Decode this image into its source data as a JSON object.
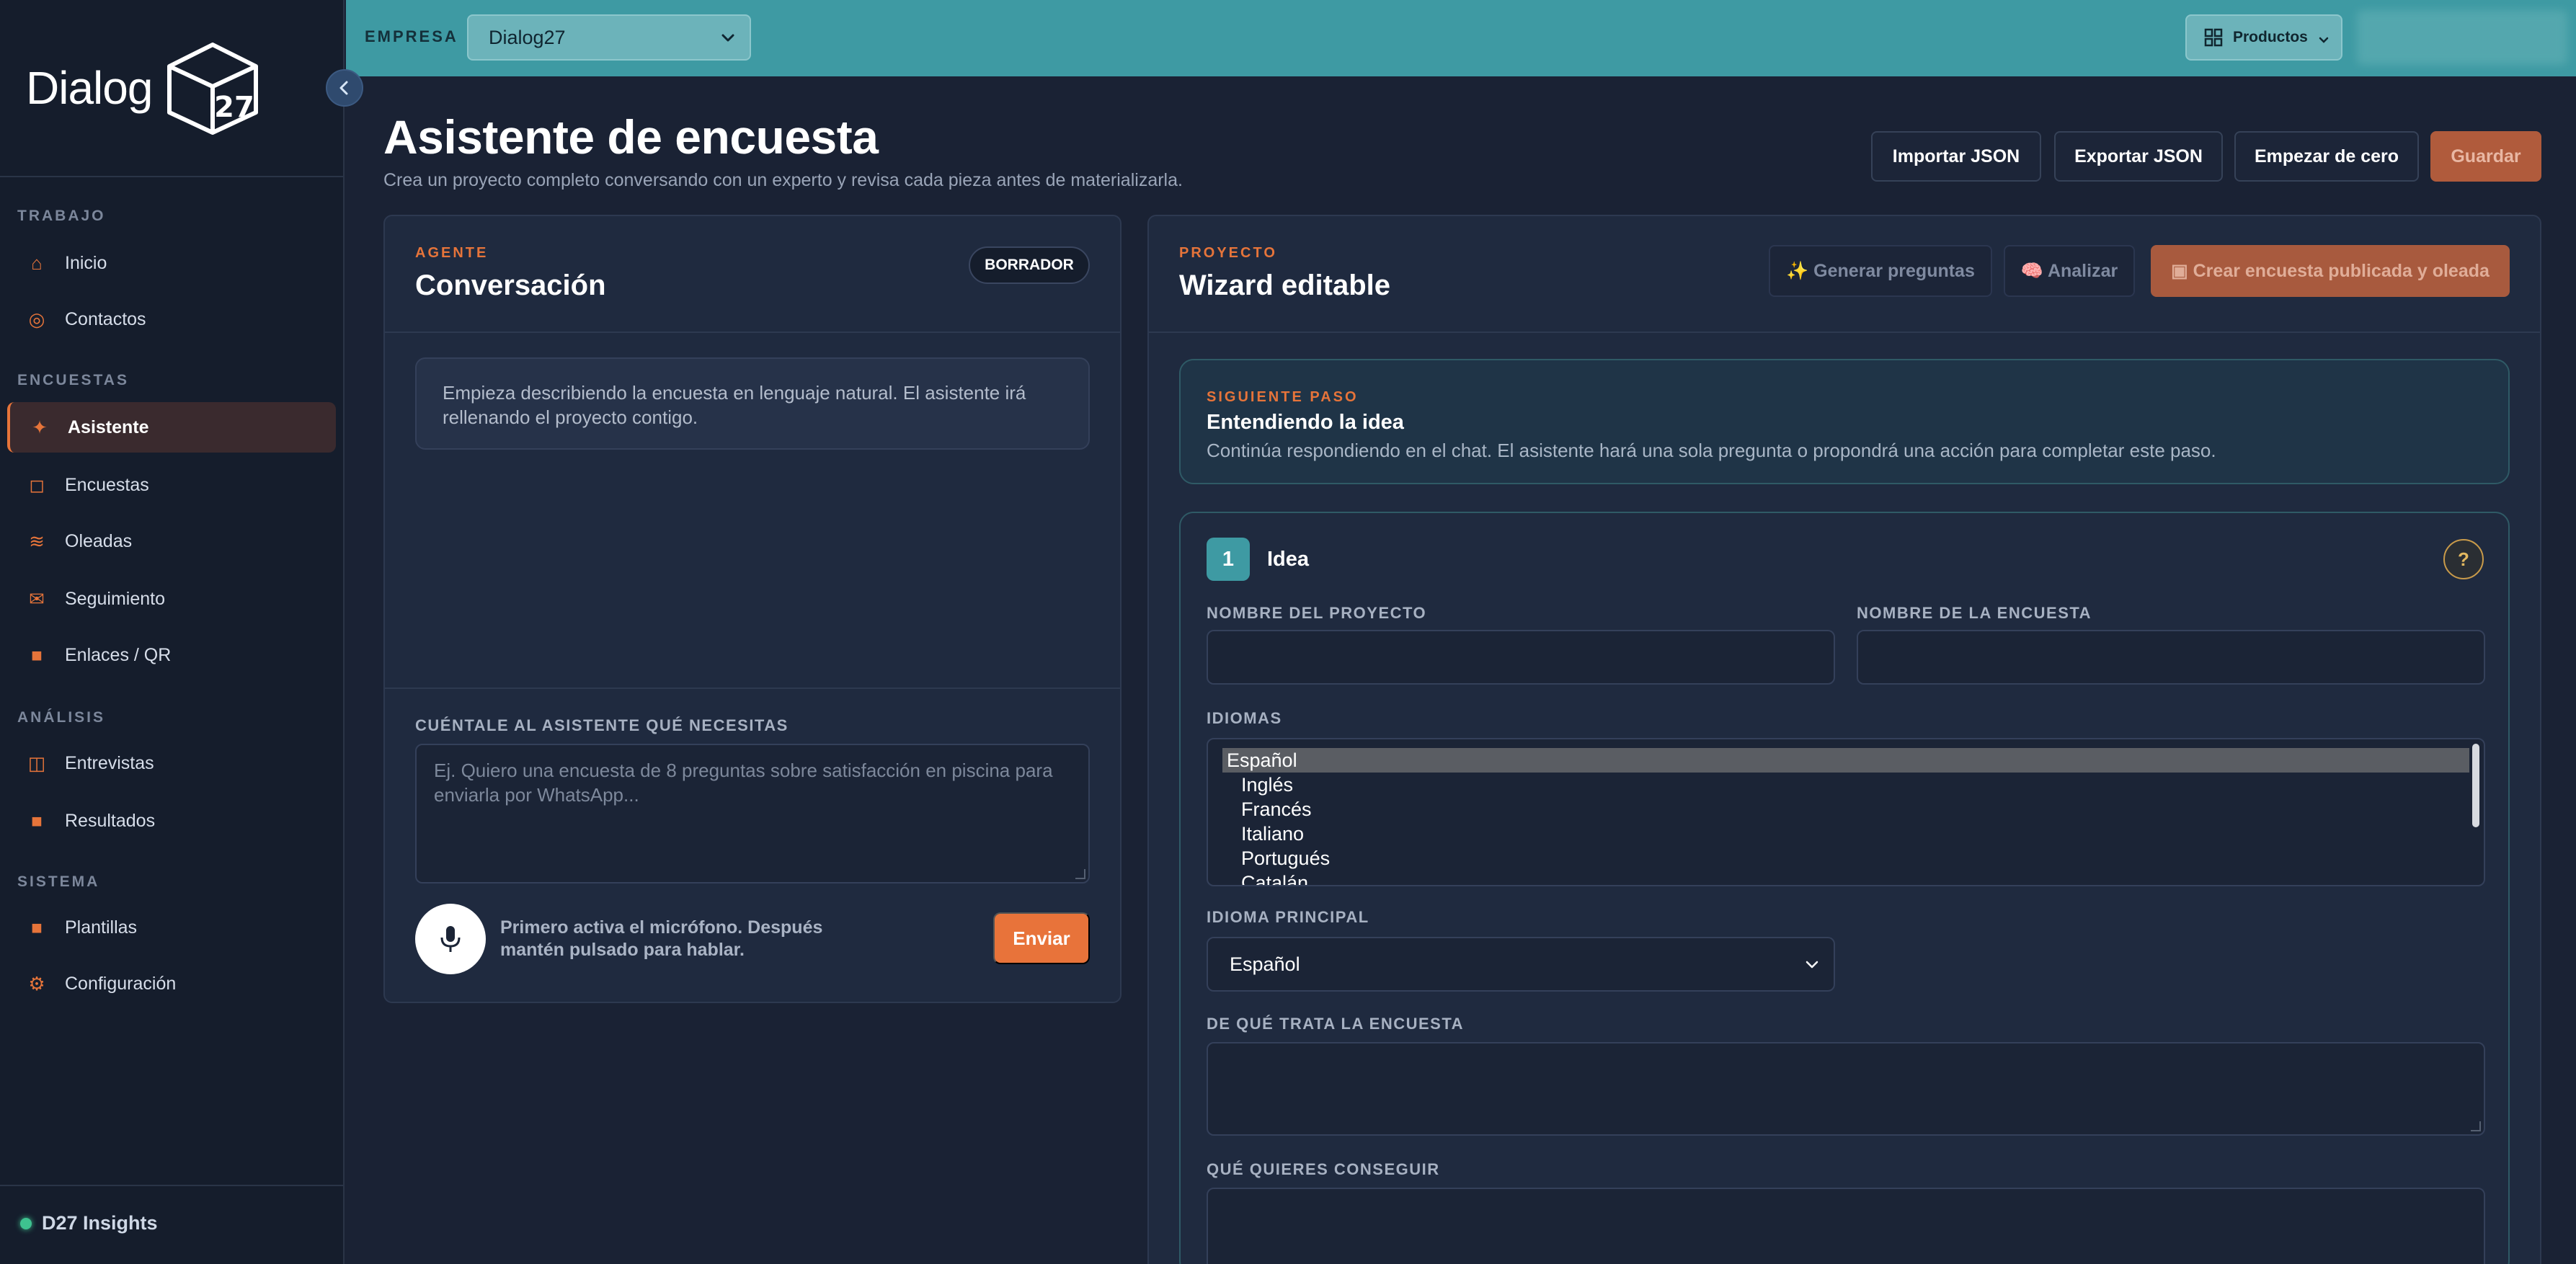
{
  "sidebar": {
    "logo_text": "Dialog",
    "logo_number": "27",
    "sections": {
      "trabajo": "TRABAJO",
      "encuestas": "ENCUESTAS",
      "analisis": "ANÁLISIS",
      "sistema": "SISTEMA"
    },
    "items": {
      "inicio": "Inicio",
      "contactos": "Contactos",
      "asistente": "Asistente",
      "encuestas": "Encuestas",
      "oleadas": "Oleadas",
      "seguimiento": "Seguimiento",
      "enlaces": "Enlaces / QR",
      "entrevistas": "Entrevistas",
      "resultados": "Resultados",
      "plantillas": "Plantillas",
      "configuracion": "Configuración"
    },
    "footer_brand": "D27 Insights",
    "accent_color": "#e6743a"
  },
  "topbar": {
    "empresa_label": "EMPRESA",
    "empresa_value": "Dialog27",
    "productos_label": "Productos",
    "bar_color": "#3e9aa3"
  },
  "header": {
    "title": "Asistente de encuesta",
    "subtitle": "Crea un proyecto completo conversando con un experto y revisa cada pieza antes de materializarla.",
    "buttons": {
      "import": "Importar JSON",
      "export": "Exportar JSON",
      "reset": "Empezar de cero",
      "save": "Guardar"
    }
  },
  "agent_panel": {
    "eyebrow": "AGENTE",
    "title": "Conversación",
    "badge": "BORRADOR",
    "hint": "Empieza describiendo la encuesta en lenguaje natural. El asistente irá rellenando el proyecto contigo.",
    "input_label": "CUÉNTALE AL ASISTENTE QUÉ NECESITAS",
    "input_placeholder": "Ej. Quiero una encuesta de 8 preguntas sobre satisfacción en piscina para enviarla por WhatsApp...",
    "mic_text": "Primero activa el micrófono. Después mantén pulsado para hablar.",
    "send_label": "Enviar"
  },
  "wizard_panel": {
    "eyebrow": "PROYECTO",
    "title": "Wizard editable",
    "buttons": {
      "generate": "✨ Generar preguntas",
      "analyze": "🧠 Analizar",
      "create": "▣ Crear encuesta publicada y oleada"
    },
    "next_step": {
      "eyebrow": "SIGUIENTE PASO",
      "title": "Entendiendo la idea",
      "description": "Continúa respondiendo en el chat. El asistente hará una sola pregunta o propondrá una acción para completar este paso."
    },
    "step": {
      "number": "1",
      "name": "Idea",
      "help": "?",
      "fields": {
        "project_name_label": "NOMBRE DEL PROYECTO",
        "survey_name_label": "NOMBRE DE LA ENCUESTA",
        "languages_label": "IDIOMAS",
        "languages": [
          "Español",
          "Inglés",
          "Francés",
          "Italiano",
          "Portugués",
          "Catalán"
        ],
        "languages_selected": "Español",
        "main_language_label": "IDIOMA PRINCIPAL",
        "main_language_value": "Español",
        "about_label": "DE QUÉ TRATA LA ENCUESTA",
        "goal_label": "QUÉ QUIERES CONSEGUIR"
      }
    }
  }
}
